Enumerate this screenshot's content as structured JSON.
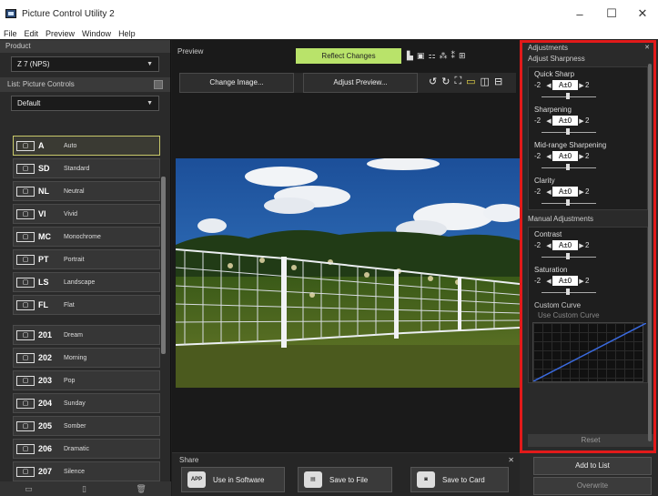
{
  "window": {
    "title": "Picture Control Utility 2",
    "minimize": "–",
    "maximize": "☐",
    "close": "✕"
  },
  "menu": [
    "File",
    "Edit",
    "Preview",
    "Window",
    "Help"
  ],
  "left": {
    "product_label": "Product",
    "product_value": "Z 7 (NPS)",
    "list_label": "List: Picture Controls",
    "list_filter": "Default",
    "items": [
      {
        "badge": "AUTO",
        "code": "A",
        "label": "Auto"
      },
      {
        "badge": "",
        "code": "SD",
        "label": "Standard"
      },
      {
        "badge": "",
        "code": "NL",
        "label": "Neutral"
      },
      {
        "badge": "",
        "code": "VI",
        "label": "Vivid"
      },
      {
        "badge": "",
        "code": "MC",
        "label": "Monochrome"
      },
      {
        "badge": "",
        "code": "PT",
        "label": "Portrait"
      },
      {
        "badge": "",
        "code": "LS",
        "label": "Landscape"
      },
      {
        "badge": "",
        "code": "FL",
        "label": "Flat"
      }
    ],
    "creative": [
      {
        "code": "201",
        "label": "Dream"
      },
      {
        "code": "202",
        "label": "Morning"
      },
      {
        "code": "203",
        "label": "Pop"
      },
      {
        "code": "204",
        "label": "Sunday"
      },
      {
        "code": "205",
        "label": "Somber"
      },
      {
        "code": "206",
        "label": "Dramatic"
      },
      {
        "code": "207",
        "label": "Silence"
      }
    ]
  },
  "preview": {
    "title": "Preview",
    "reflect_label": "Reflect Changes",
    "change_image": "Change Image...",
    "adjust_preview": "Adjust Preview..."
  },
  "share": {
    "title": "Share",
    "use_software": "Use in Software",
    "save_file": "Save to File",
    "save_card": "Save to Card"
  },
  "adjust": {
    "title": "Adjustments",
    "sharpness_title": "Adjust Sharpness",
    "quick_sharp": {
      "label": "Quick Sharp",
      "min": "-2",
      "max": "2",
      "value": "A±0"
    },
    "sharpening": {
      "label": "Sharpening",
      "min": "-2",
      "max": "2",
      "value": "A±0"
    },
    "midrange": {
      "label": "Mid-range Sharpening",
      "min": "-2",
      "max": "2",
      "value": "A±0"
    },
    "clarity": {
      "label": "Clarity",
      "min": "-2",
      "max": "2",
      "value": "A±0"
    },
    "manual_title": "Manual Adjustments",
    "contrast": {
      "label": "Contrast",
      "min": "-2",
      "max": "2",
      "value": "A±0"
    },
    "saturation": {
      "label": "Saturation",
      "min": "-2",
      "max": "2",
      "value": "A±0"
    },
    "curve_title": "Custom Curve",
    "use_curve": "Use Custom Curve",
    "reset": "Reset",
    "add_to_list": "Add to List",
    "overwrite": "Overwrite"
  },
  "colors": {
    "accent": "#b9e36a",
    "highlight": "#e21a1a"
  }
}
